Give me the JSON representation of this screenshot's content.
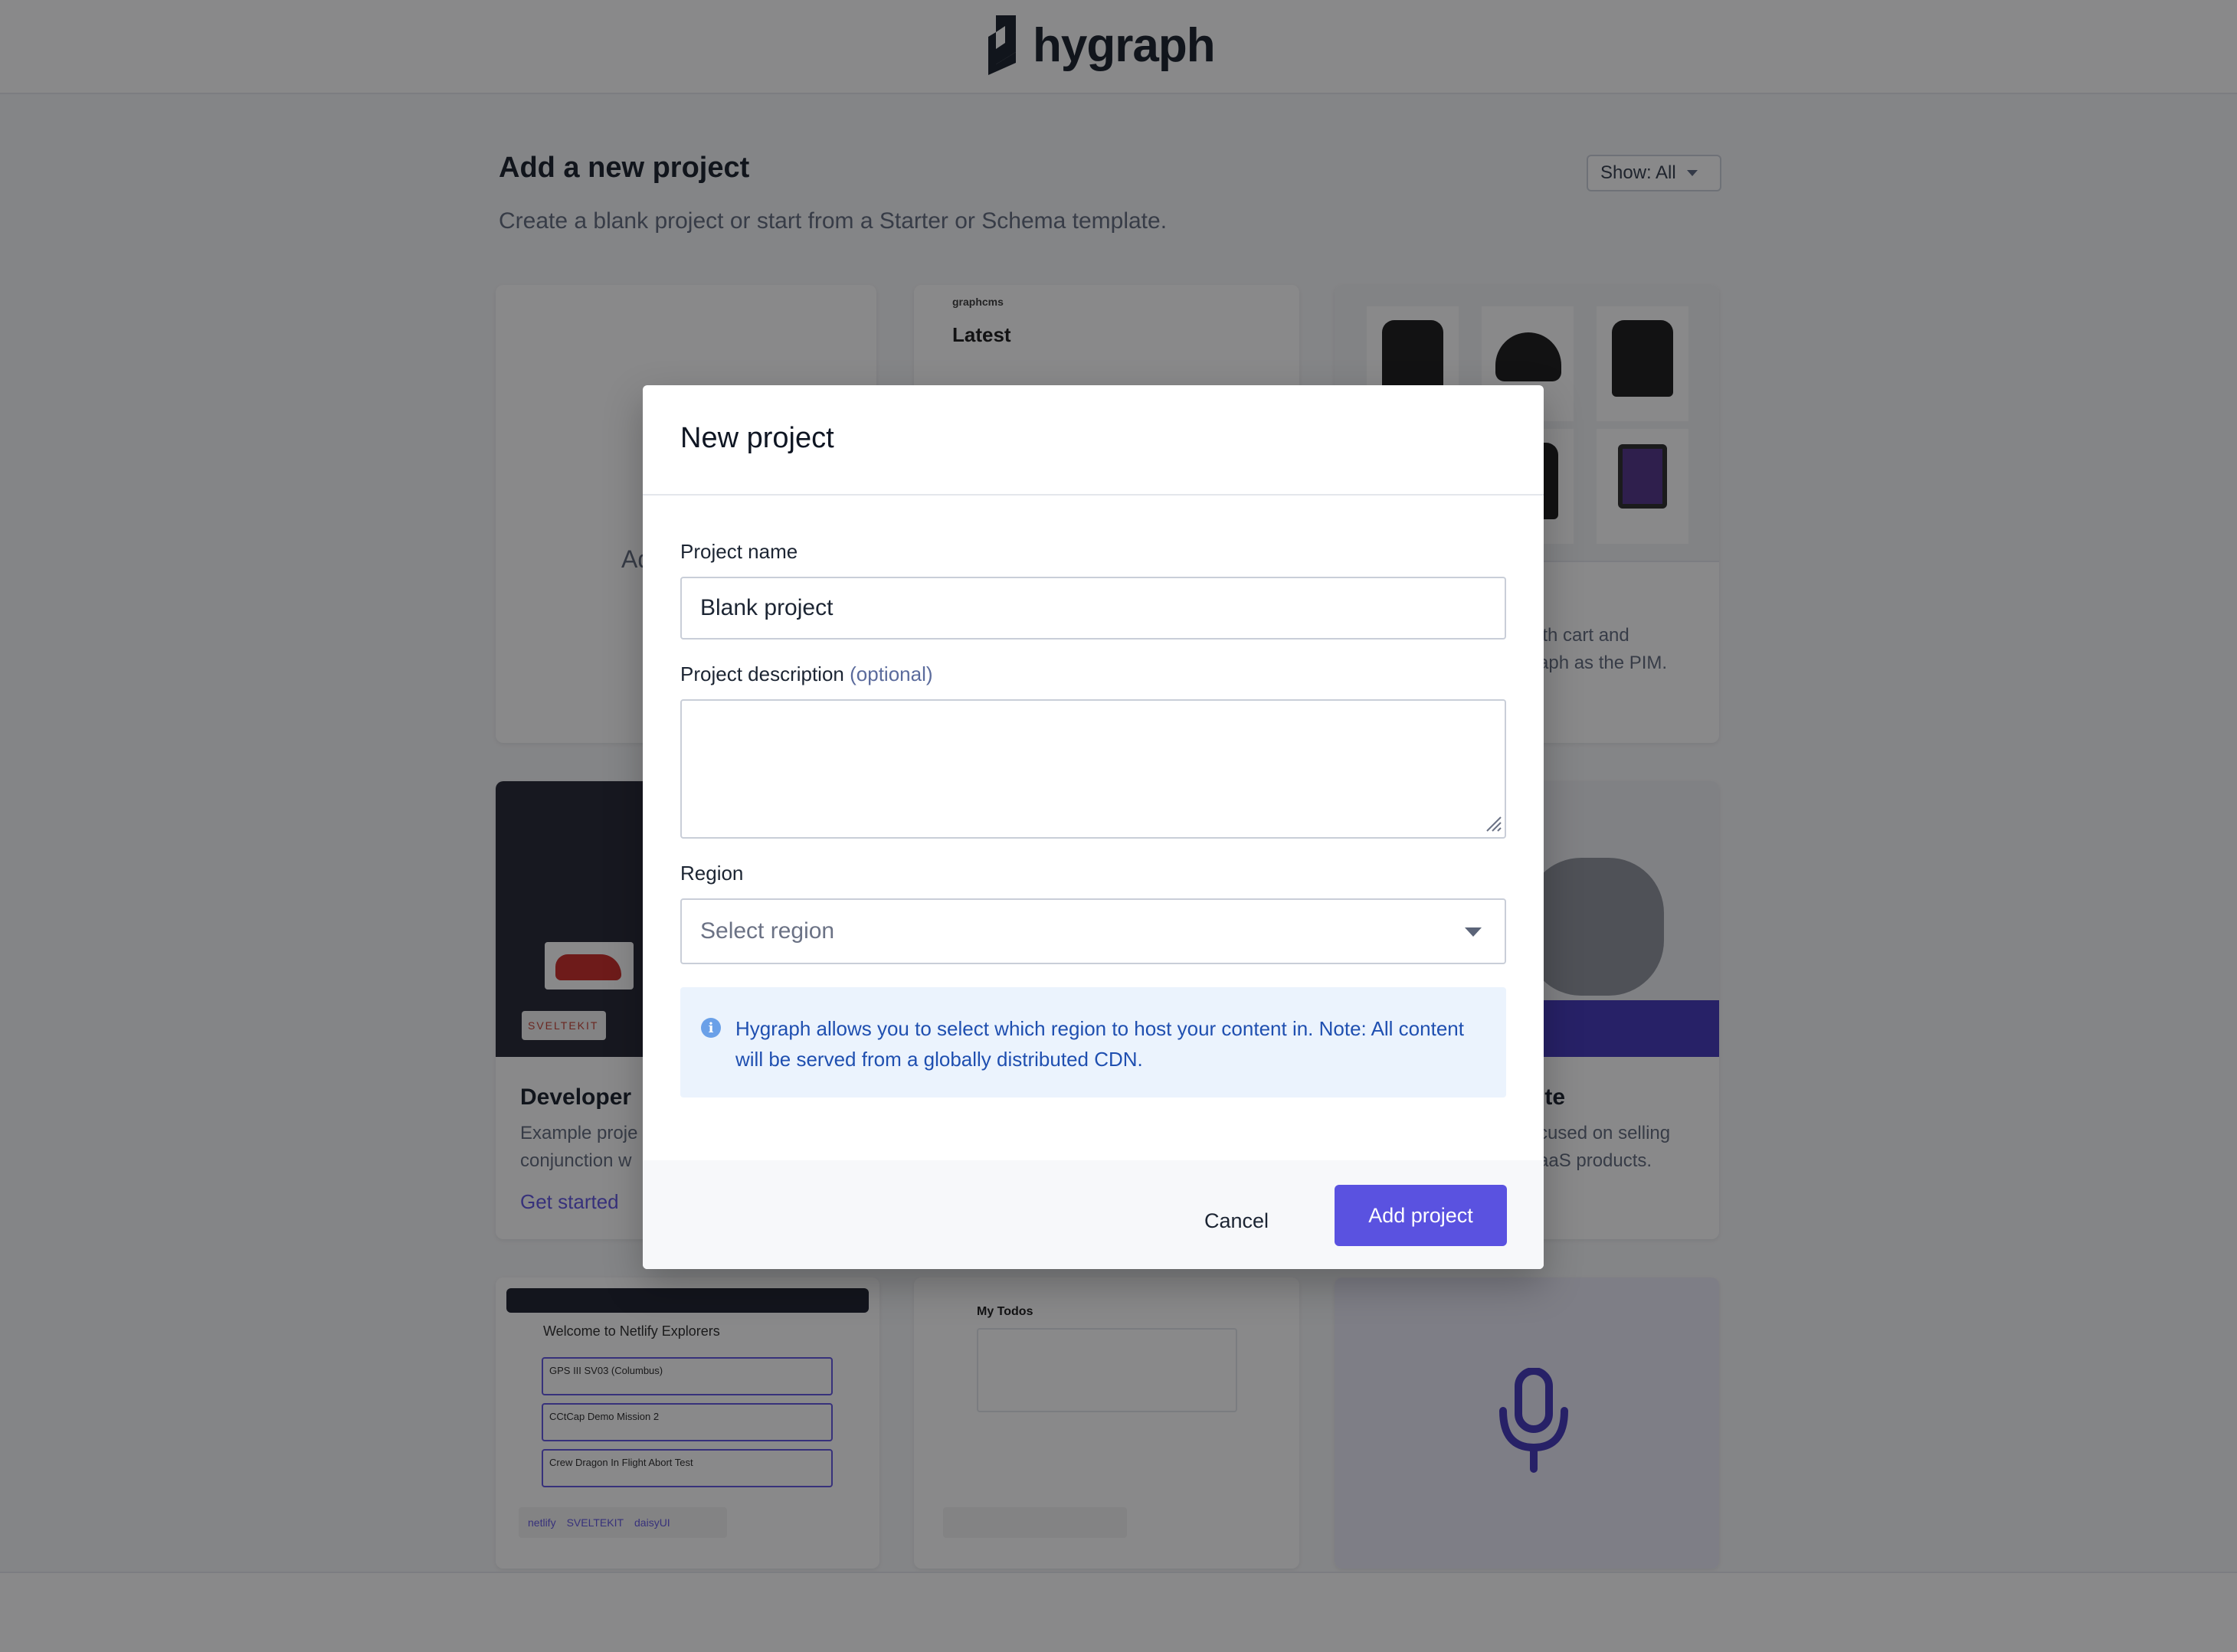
{
  "header": {
    "brand": "hygraph"
  },
  "main": {
    "title": "Add a new project",
    "subtitle": "Create a blank project or start from a Starter or Schema template.",
    "filter_label": "Show: All"
  },
  "cards": {
    "blank": {
      "partial_label": "Ad"
    },
    "blog": {
      "thumb_brand": "graphcms",
      "thumb_heading": "Latest"
    },
    "commerce": {
      "desc_line1": "ith cart and",
      "desc_line2": "aph as the PIM."
    },
    "developer": {
      "title": "Developer",
      "desc_line1": "Example proje",
      "desc_line2": "conjunction w",
      "link": "Get started",
      "badge": "SVELTEKIT"
    },
    "saas": {
      "title": "ite",
      "desc_line1": "cused on selling",
      "desc_line2": "aaS products."
    },
    "explorers": {
      "thumb_title": "Welcome to Netlify Explorers",
      "items": [
        "GPS III SV03 (Columbus)",
        "CCtCap Demo Mission 2",
        "Crew Dragon In Flight Abort Test"
      ],
      "logos": [
        "netlify",
        "SVELTEKIT",
        "daisyUI"
      ]
    },
    "todos": {
      "thumb_title": "My Todos"
    }
  },
  "modal": {
    "title": "New project",
    "name_label": "Project name",
    "name_value": "Blank project",
    "desc_label": "Project description",
    "desc_optional": "(optional)",
    "desc_value": "",
    "region_label": "Region",
    "region_placeholder": "Select region",
    "info_text": "Hygraph allows you to select which region to host your content in. Note: All content will be served from a globally distributed CDN.",
    "cancel_label": "Cancel",
    "submit_label": "Add project"
  },
  "colors": {
    "accent": "#5a52e0",
    "info_bg": "#ebf3fd",
    "info_text": "#1f4fb0",
    "overlay": "rgba(20,20,22,0.5)"
  },
  "icons": [
    "hygraph-logo-icon",
    "chevron-down-icon",
    "info-icon",
    "resize-grip-icon",
    "microphone-icon"
  ]
}
